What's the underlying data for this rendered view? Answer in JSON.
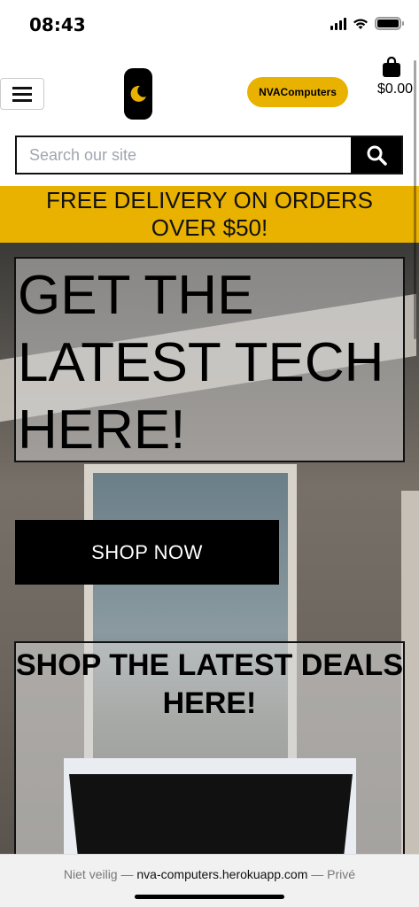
{
  "status_bar": {
    "time": "08:43"
  },
  "header": {
    "menu_icon": "hamburger-icon",
    "logo_icon": "moon-logo-icon",
    "brand_label": "NVAComputers",
    "cart_icon": "shopping-bag-icon",
    "cart_total": "$0.00"
  },
  "search": {
    "placeholder": "Search our site",
    "button_icon": "search-icon"
  },
  "promo": {
    "text": "FREE DELIVERY ON ORDERS OVER $50!"
  },
  "hero": {
    "title": "GET THE LATEST TECH HERE!",
    "cta_label": "SHOP NOW",
    "deals_title": "SHOP THE LATEST DEALS HERE!"
  },
  "safari": {
    "security": "Niet veilig",
    "separator_1": "—",
    "url": "nva-computers.herokuapp.com",
    "separator_2": "—",
    "mode": "Privé"
  },
  "colors": {
    "accent": "#e9b200",
    "dark": "#000000"
  }
}
